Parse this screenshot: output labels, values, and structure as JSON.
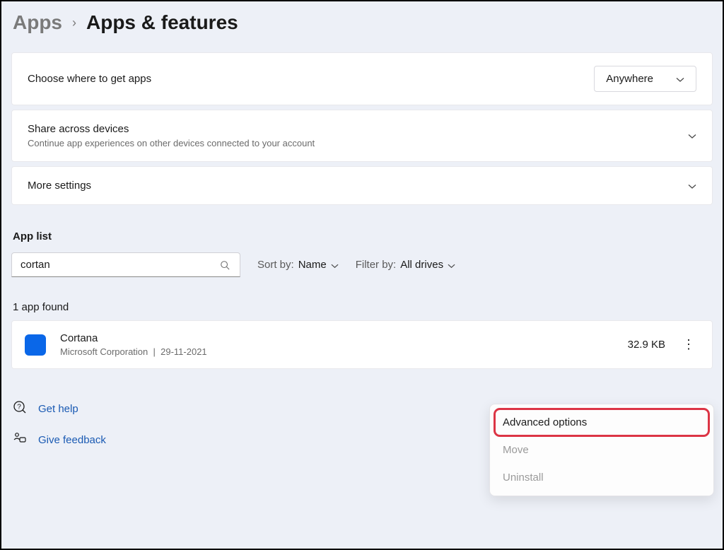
{
  "breadcrumb": {
    "parent": "Apps",
    "current": "Apps & features"
  },
  "choose_apps": {
    "title": "Choose where to get apps",
    "value": "Anywhere"
  },
  "share_devices": {
    "title": "Share across devices",
    "subtitle": "Continue app experiences on other devices connected to your account"
  },
  "more_settings": {
    "title": "More settings"
  },
  "app_list": {
    "label": "App list",
    "search_value": "cortan",
    "sort_label": "Sort by:",
    "sort_value": "Name",
    "filter_label": "Filter by:",
    "filter_value": "All drives",
    "count_text": "1 app found"
  },
  "app": {
    "name": "Cortana",
    "publisher": "Microsoft Corporation",
    "date": "29-11-2021",
    "size": "32.9 KB"
  },
  "context_menu": {
    "advanced": "Advanced options",
    "move": "Move",
    "uninstall": "Uninstall"
  },
  "help": {
    "get_help": "Get help",
    "feedback": "Give feedback"
  }
}
